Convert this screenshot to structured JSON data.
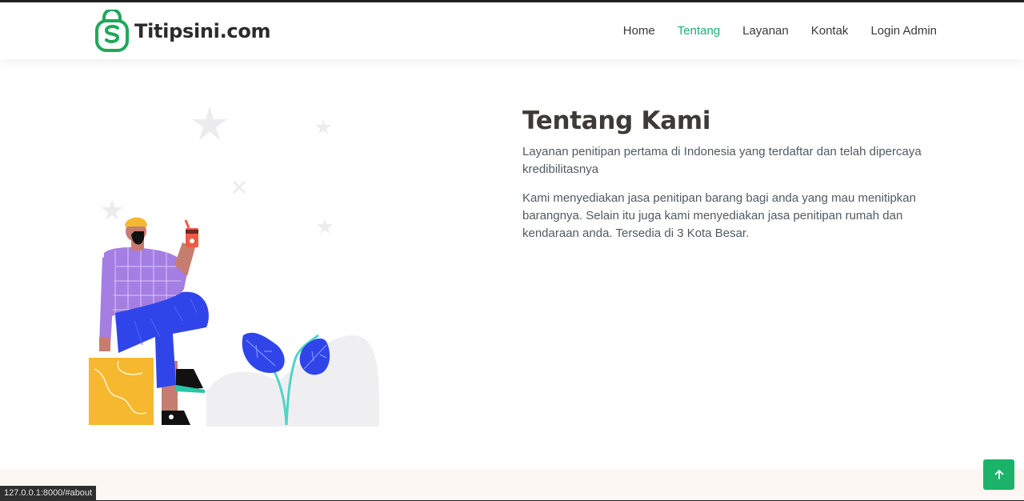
{
  "brand": {
    "name": "Titipsini.com",
    "accent": "#1bb07a"
  },
  "nav": {
    "items": [
      {
        "label": "Home"
      },
      {
        "label": "Tentang",
        "active": true
      },
      {
        "label": "Layanan"
      },
      {
        "label": "Kontak"
      },
      {
        "label": "Login Admin"
      }
    ]
  },
  "about": {
    "title": "Tentang Kami",
    "p1": "Layanan penitipan pertama di Indonesia yang terdaftar dan telah dipercaya kredibilitasnya",
    "p2": "Kami menyediakan jasa penitipan barang bagi anda yang mau menitipkan barangnya. Selain itu juga kami menyediakan jasa penitipan rumah dan kendaraan anda. Tersedia di 3 Kota Besar."
  },
  "status_bar": {
    "url": "127.0.0.1:8000/#about"
  },
  "back_to_top": {
    "icon": "arrow-up-icon",
    "color": "#1bb36a"
  }
}
